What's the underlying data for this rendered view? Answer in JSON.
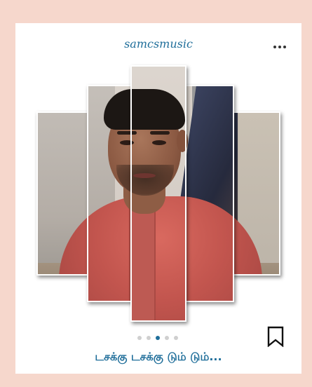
{
  "post": {
    "username": "samcsmusic",
    "caption": "டசக்கு டசக்கு டும் டும்...",
    "carousel": {
      "count": 5,
      "active_index": 2
    },
    "icons": {
      "more": "more-dots-icon",
      "bookmark": "bookmark-icon"
    },
    "colors": {
      "accent": "#1f6e9a",
      "background": "#f6d7cc",
      "card": "#ffffff"
    }
  }
}
